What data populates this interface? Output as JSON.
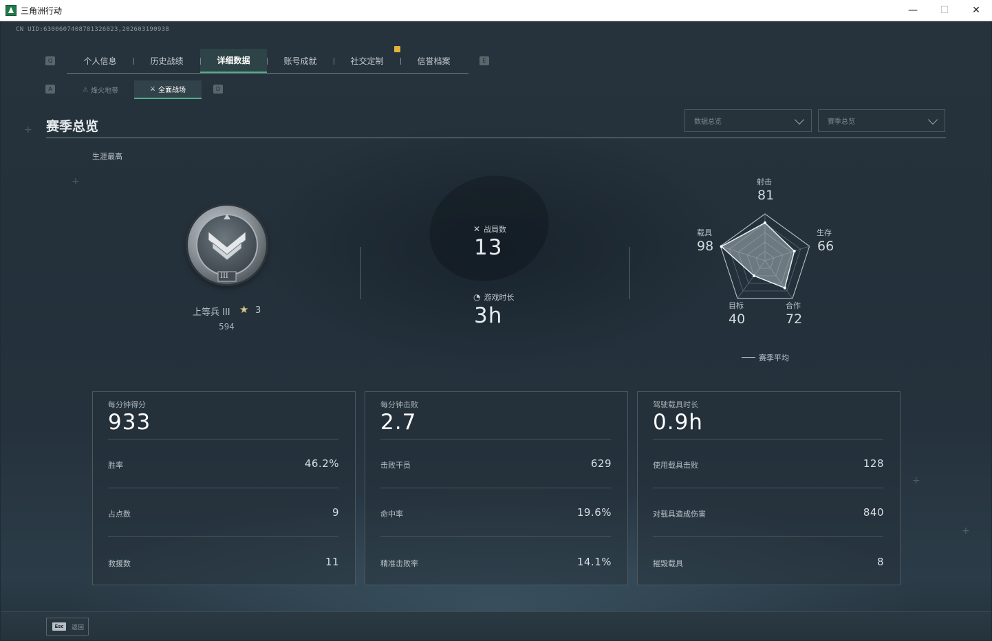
{
  "window": {
    "title": "三角洲行动",
    "controls": {
      "minimize": "—",
      "maximize": "☐",
      "close": "✕"
    }
  },
  "uid_text": "CN UID:6300607408781326023,202603190938",
  "hotkeys": {
    "tab_left": "Q",
    "tab_right": "E",
    "sub_left": "A",
    "sub_right": "D"
  },
  "tabs": [
    {
      "label": "个人信息",
      "active": false
    },
    {
      "label": "历史战绩",
      "active": false
    },
    {
      "label": "详细数据",
      "active": true
    },
    {
      "label": "账号成就",
      "active": false
    },
    {
      "label": "社交定制",
      "active": false
    },
    {
      "label": "信誉档案",
      "active": false
    }
  ],
  "subtabs": [
    {
      "label": "烽火地带",
      "icon": "⚠",
      "active": false
    },
    {
      "label": "全面战场",
      "icon": "⚔",
      "active": true
    }
  ],
  "section_title": "赛季总览",
  "dropdowns": [
    {
      "label": "数据总览"
    },
    {
      "label": "赛季总览"
    }
  ],
  "career_label": "生涯最高",
  "rank": {
    "name": "上等兵 III",
    "stars": "3",
    "score": "594",
    "roman": "III"
  },
  "stats": {
    "matches": {
      "label": "战局数",
      "value": "13",
      "icon": "crossed-swords-icon"
    },
    "playtime": {
      "label": "游戏时长",
      "value": "3h",
      "icon": "stopwatch-icon"
    }
  },
  "radar": {
    "axes": [
      {
        "label": "射击",
        "value": "81"
      },
      {
        "label": "生存",
        "value": "66"
      },
      {
        "label": "合作",
        "value": "72"
      },
      {
        "label": "目标",
        "value": "40"
      },
      {
        "label": "载具",
        "value": "98"
      }
    ],
    "values": [
      81,
      66,
      72,
      40,
      98
    ],
    "max": 100,
    "legend": "赛季平均"
  },
  "cards": [
    {
      "title": "每分钟得分",
      "value": "933",
      "rows": [
        {
          "label": "胜率",
          "value": "46.2%"
        },
        {
          "label": "占点数",
          "value": "9"
        },
        {
          "label": "救援数",
          "value": "11"
        }
      ]
    },
    {
      "title": "每分钟击败",
      "value": "2.7",
      "rows": [
        {
          "label": "击败干员",
          "value": "629"
        },
        {
          "label": "命中率",
          "value": "19.6%"
        },
        {
          "label": "精准击败率",
          "value": "14.1%"
        }
      ]
    },
    {
      "title": "驾驶载具时长",
      "value": "0.9h",
      "rows": [
        {
          "label": "使用载具击败",
          "value": "128"
        },
        {
          "label": "对载具造成伤害",
          "value": "840"
        },
        {
          "label": "摧毁载具",
          "value": "8"
        }
      ]
    }
  ],
  "esc": {
    "key": "Esc",
    "label": "返回"
  },
  "colors": {
    "accent": "#4fb08a",
    "notify": "#e1b13a",
    "background": "#25323d"
  }
}
